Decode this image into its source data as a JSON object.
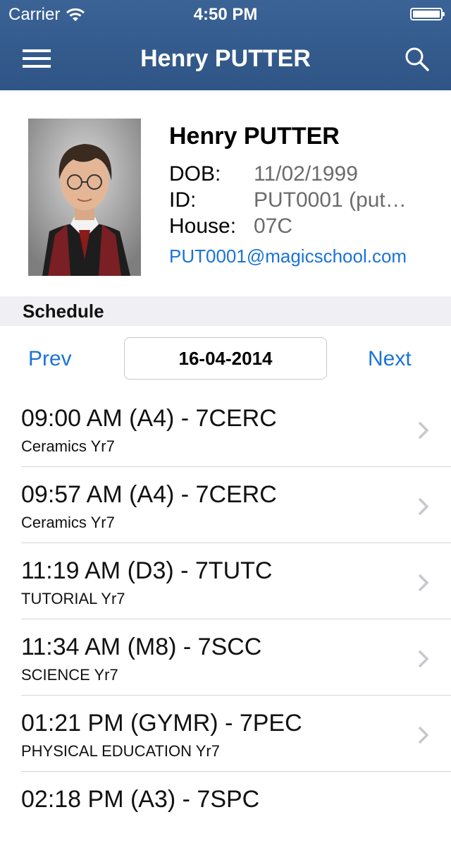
{
  "status_bar": {
    "carrier": "Carrier",
    "time": "4:50 PM"
  },
  "nav": {
    "title": "Henry PUTTER"
  },
  "profile": {
    "name": "Henry PUTTER",
    "dob_label": "DOB:",
    "dob": "11/02/1999",
    "id_label": "ID:",
    "id": "PUT0001 (put…",
    "house_label": "House:",
    "house": "07C",
    "email": "PUT0001@magicschool.com"
  },
  "schedule": {
    "section_title": "Schedule",
    "prev_label": "Prev",
    "next_label": "Next",
    "date": "16-04-2014",
    "items": [
      {
        "title": "09:00 AM (A4) - 7CERC",
        "subtitle": "Ceramics Yr7"
      },
      {
        "title": "09:57 AM (A4) - 7CERC",
        "subtitle": "Ceramics Yr7"
      },
      {
        "title": "11:19 AM (D3) - 7TUTC",
        "subtitle": "TUTORIAL Yr7"
      },
      {
        "title": "11:34 AM (M8) - 7SCC",
        "subtitle": "SCIENCE Yr7"
      },
      {
        "title": "01:21 PM (GYMR) - 7PEC",
        "subtitle": "PHYSICAL EDUCATION Yr7"
      },
      {
        "title": "02:18 PM (A3) - 7SPC",
        "subtitle": ""
      }
    ]
  },
  "colors": {
    "nav_bar": "#2f5486",
    "link": "#1a73d8",
    "section_bg": "#efeff4"
  },
  "icons": {
    "menu": "hamburger-menu-icon",
    "search": "search-icon",
    "wifi": "wifi-icon",
    "battery": "battery-icon",
    "chevron": "chevron-right-icon"
  }
}
